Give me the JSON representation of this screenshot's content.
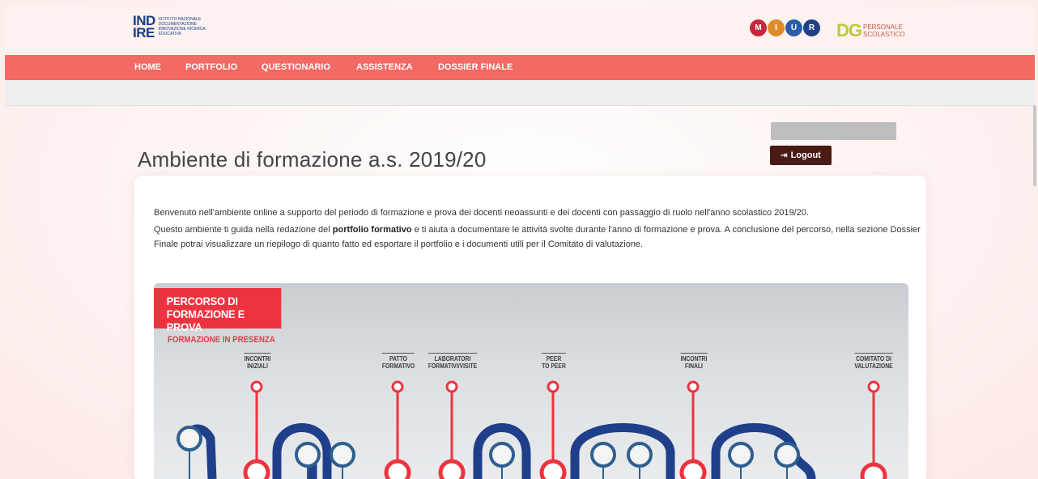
{
  "header": {
    "indire_mark": "IND\nIRE",
    "indire_text": "Istituto Nazionale Documentazione Innovazione Ricerca Educativa",
    "miur_letters": [
      "M",
      "I",
      "U",
      "R"
    ],
    "dg_mark": "DG",
    "dg_text": "Personale Scolastico"
  },
  "nav": {
    "items": [
      {
        "label": "HOME"
      },
      {
        "label": "PORTFOLIO"
      },
      {
        "label": "QUESTIONARIO"
      },
      {
        "label": "ASSISTENZA"
      },
      {
        "label": "DOSSIER FINALE"
      }
    ]
  },
  "page": {
    "title": "Ambiente di formazione a.s. 2019/20",
    "logout_label": "Logout",
    "intro_1": "Benvenuto nell'ambiente online a supporto del periodo di formazione e prova dei docenti neoassunti e dei docenti con passaggio di ruolo nell'anno scolastico 2019/20.",
    "intro_2_before": "Questo ambiente ti guida nella redazione del ",
    "intro_2_bold": "portfolio formativo",
    "intro_2_after": " e ti aiuta a documentare le attività svolte durante l'anno di formazione e prova. A conclusione del percorso, nella sezione Dossier Finale potrai visualizzare un riepilogo di quanto fatto ed esportare il portfolio e i documenti utili per il Comitato di valutazione."
  },
  "infographic": {
    "banner_line1": "PERCORSO DI",
    "banner_line2": "FORMAZIONE E PROVA",
    "subtitle": "FORMAZIONE IN PRESENZA",
    "stops": [
      {
        "label": "INCONTRI\nINIZIALI"
      },
      {
        "label": "PATTO\nFORMATIVO"
      },
      {
        "label": "LABORATORI\nFORMATIVI/VISITE"
      },
      {
        "label": "PEER\nTO PEER"
      },
      {
        "label": "INCONTRI\nFINALI"
      },
      {
        "label": "COMITATO DI\nVALUTAZIONE"
      }
    ],
    "colors": {
      "red": "#ee3340",
      "blue": "#1f3f8a",
      "node_blue": "#2f5f8f"
    }
  }
}
